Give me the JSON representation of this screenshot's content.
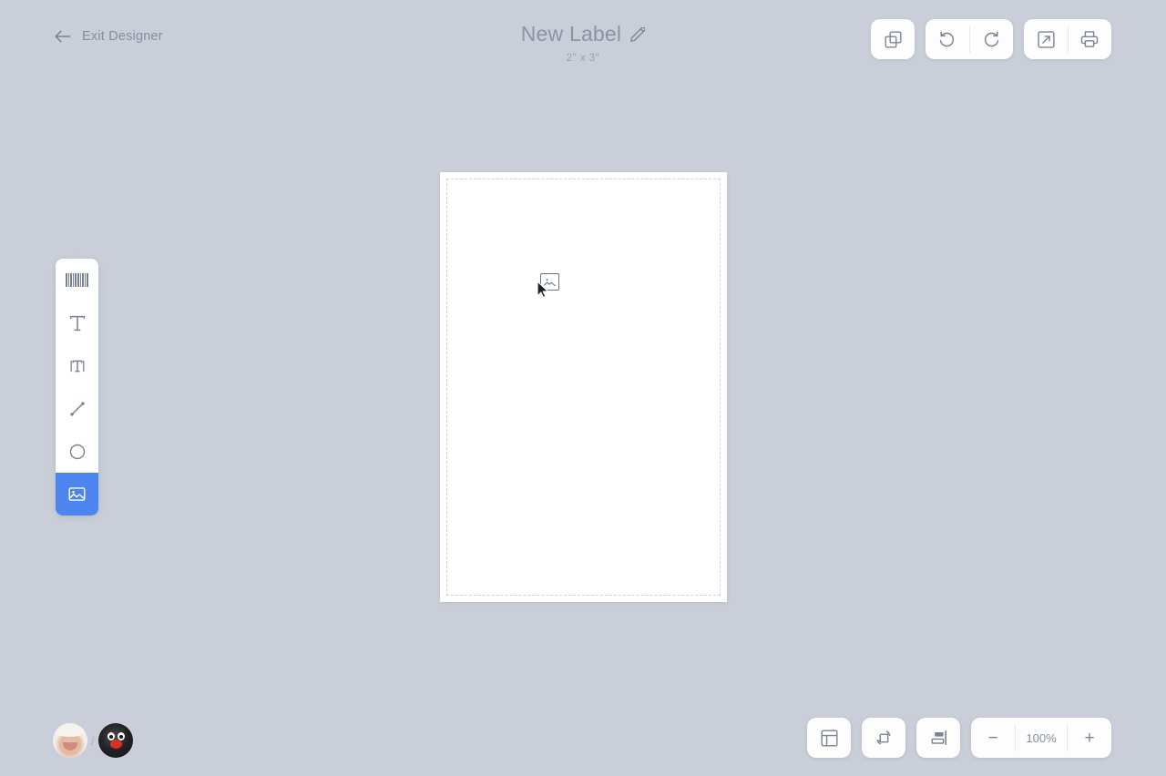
{
  "app": {
    "background_color": "#c9ced8",
    "accent_color": "#4c85ef"
  },
  "topbar": {
    "exit": {
      "label": "Exit Designer",
      "icon": "arrow-left-icon"
    },
    "title": "New Label",
    "title_edit_icon": "pencil-icon",
    "size_label": "2\" x 3\"",
    "actions": [
      {
        "name": "duplicate-button",
        "icon": "duplicate-icon",
        "tooltip": "Duplicate"
      },
      {
        "name": "undo-button",
        "icon": "undo-icon",
        "tooltip": "Undo"
      },
      {
        "name": "redo-button",
        "icon": "redo-icon",
        "tooltip": "Redo"
      },
      {
        "name": "export-button",
        "icon": "export-icon",
        "tooltip": "Export"
      },
      {
        "name": "print-button",
        "icon": "print-icon",
        "tooltip": "Print"
      }
    ]
  },
  "tool_rail": {
    "items": [
      {
        "name": "tool-barcode",
        "icon": "barcode-icon",
        "active": false
      },
      {
        "name": "tool-text",
        "icon": "text-icon",
        "active": false
      },
      {
        "name": "tool-text-field",
        "icon": "text-field-icon",
        "active": false
      },
      {
        "name": "tool-line",
        "icon": "line-icon",
        "active": false
      },
      {
        "name": "tool-shape",
        "icon": "circle-icon",
        "active": false
      },
      {
        "name": "tool-image",
        "icon": "image-icon",
        "active": true
      }
    ]
  },
  "canvas": {
    "sheet_color": "#ffffff",
    "margin_guide": "dashed",
    "drag_ghost_icon": "image-icon",
    "cursor": "arrow-cursor"
  },
  "presence": {
    "separator": "/",
    "avatars": [
      {
        "name": "avatar-user-1"
      },
      {
        "name": "avatar-user-2"
      }
    ]
  },
  "bottom_tools": {
    "actions": [
      {
        "name": "layout-panel-button",
        "icon": "grid-layout-icon"
      },
      {
        "name": "rotate-button",
        "icon": "rotate-icon"
      },
      {
        "name": "align-button",
        "icon": "align-right-icon"
      }
    ],
    "zoom": {
      "decrease_label": "−",
      "value": "100%",
      "increase_label": "+"
    }
  }
}
